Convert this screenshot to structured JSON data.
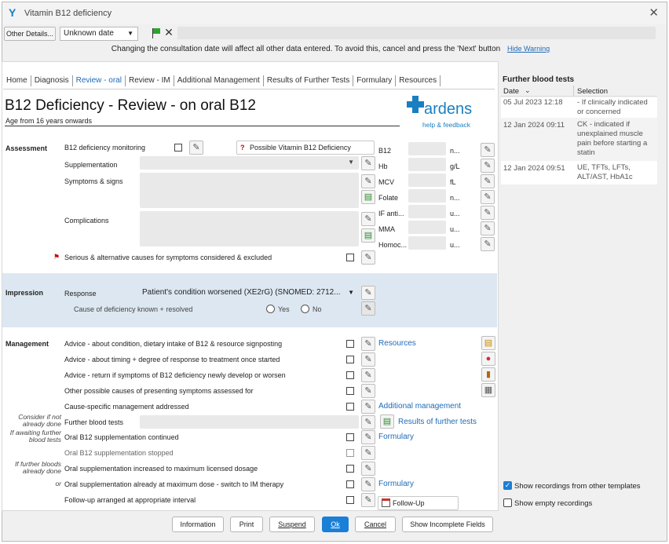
{
  "window": {
    "title": "Vitamin B12 deficiency"
  },
  "toolbar": {
    "other_details": "Other Details...",
    "date_select": "Unknown date"
  },
  "warning": {
    "text": "Changing the consultation date will affect all other data entered. To avoid this, cancel and press the 'Next' button",
    "hide": "Hide Warning"
  },
  "tabs": [
    "Home",
    "Diagnosis",
    "Review - oral",
    "Review - IM",
    "Additional Management",
    "Results of Further Tests",
    "Formulary",
    "Resources"
  ],
  "header": {
    "title": "B12 Deficiency - Review - on oral B12",
    "subtitle": "Age from 16 years onwards",
    "logo": "ardens",
    "logo_sub": "help & feedback"
  },
  "assessment": {
    "section": "Assessment",
    "monitoring": "B12 deficiency monitoring",
    "possible_btn": "Possible Vitamin B12 Deficiency",
    "supplementation": "Supplementation",
    "symptoms": "Symptoms & signs",
    "complications": "Complications",
    "serious": "Serious & alternative causes for symptoms considered & excluded"
  },
  "labs": [
    {
      "name": "B12",
      "unit": "n..."
    },
    {
      "name": "Hb",
      "unit": "g/L"
    },
    {
      "name": "MCV",
      "unit": "fL"
    },
    {
      "name": "Folate",
      "unit": "n..."
    },
    {
      "name": "IF anti...",
      "unit": "u..."
    },
    {
      "name": "MMA",
      "unit": "u..."
    },
    {
      "name": "Homoc...",
      "unit": "u..."
    }
  ],
  "impression": {
    "section": "Impression",
    "response": "Response",
    "response_value": "Patient's condition worsened (XE2rG) (SNOMED: 2712...",
    "cause": "Cause of deficiency known + resolved",
    "yes": "Yes",
    "no": "No"
  },
  "management": {
    "section": "Management",
    "items": [
      "Advice - about condition, dietary intake of B12 & resource signposting",
      "Advice - about timing + degree of response to treatment once started",
      "Advice - return if symptoms of B12 deficiency newly develop or worsen",
      "Other possible causes of presenting symptoms assessed for",
      "Cause-specific management addressed",
      "Further blood tests",
      "Oral B12 supplementation continued",
      "Oral B12 supplementation stopped",
      "Oral supplementation increased to maximum licensed dosage",
      "Oral supplementation already at maximum dose - switch to IM therapy",
      "Follow-up arranged at appropriate interval"
    ],
    "side_notes": [
      "Consider if not already done",
      "If awaiting further blood tests",
      "If further bloods already done",
      "or"
    ],
    "links": {
      "resources": "Resources",
      "additional": "Additional management",
      "results": "Results of further tests",
      "formulary1": "Formulary",
      "formulary2": "Formulary",
      "follow_up": "Follow-Up"
    }
  },
  "right_panel": {
    "title": "Further blood tests",
    "col_date": "Date",
    "col_selection": "Selection",
    "rows": [
      {
        "date": "05 Jul 2023 12:18",
        "selection": "- If clinically indicated or concerned"
      },
      {
        "date": "12 Jan 2024 09:11",
        "selection": "CK - indicated if unexplained muscle pain before starting a statin"
      },
      {
        "date": "12 Jan 2024 09:51",
        "selection": "UE, TFTs, LFTs, ALT/AST, HbA1c"
      }
    ],
    "show_other": "Show recordings from other templates",
    "show_empty": "Show empty recordings"
  },
  "buttons": {
    "information": "Information",
    "print": "Print",
    "suspend": "Suspend",
    "ok": "Ok",
    "cancel": "Cancel",
    "show_incomplete": "Show Incomplete Fields"
  },
  "colors": {
    "accent": "#1a7fc1",
    "impression_bg": "#dde7f1",
    "ok_btn": "#1a7fd6",
    "link": "#1f6bb8"
  }
}
